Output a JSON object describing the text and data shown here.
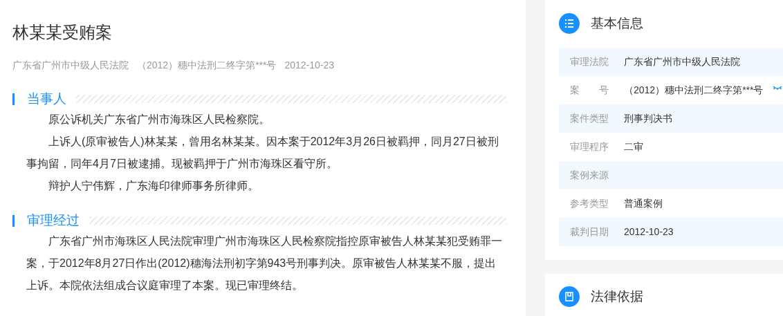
{
  "title": "林某某受贿案",
  "meta": [
    "广东省广州市中级人民法院",
    "（2012）穗中法刑二终字第***号",
    "2012-10-23"
  ],
  "sections": [
    {
      "heading": "当事人",
      "paragraphs": [
        "原公诉机关广东省广州市海珠区人民检察院。",
        "上诉人(原审被告人)林某某，曾用名林某某。因本案于2012年3月26日被羁押，同月27日被刑事拘留，同年4月7日被逮捕。现被羁押于广州市海珠区看守所。",
        "辩护人宁伟辉，广东海印律师事务所律师。"
      ]
    },
    {
      "heading": "审理经过",
      "paragraphs": [
        "广东省广州市海珠区人民法院审理广州市海珠区人民检察院指控原审被告人林某某犯受贿罪一案，于2012年8月27日作出(2012)穗海法刑初字第943号刑事判决。原审被告人林某某不服，提出上诉。本院依法组成合议庭审理了本案。现已审理终结。"
      ]
    }
  ],
  "basic_info": {
    "title": "基本信息",
    "rows": [
      {
        "label": "审理法院",
        "value": "广东省广州市中级人民法院"
      },
      {
        "label": "案　　号",
        "value": "（2012）穗中法刑二终字第***号",
        "has_action": true
      },
      {
        "label": "案件类型",
        "value": "刑事判决书"
      },
      {
        "label": "审理程序",
        "value": "二审"
      },
      {
        "label": "案例来源"
      },
      {
        "label": "参考类型",
        "value": "普通案例"
      },
      {
        "label": "裁判日期",
        "value": "2012-10-23"
      }
    ]
  },
  "legal_basis": {
    "title": "法律依据"
  }
}
